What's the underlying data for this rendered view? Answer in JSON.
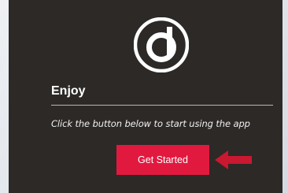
{
  "onboarding": {
    "title": "Enjoy",
    "description": "Click the button below to start using the app",
    "button_label": "Get Started"
  },
  "icons": {
    "logo": "circle-d-logo",
    "pointer": "arrow-left-icon"
  },
  "colors": {
    "panel_bg": "#2d2927",
    "accent": "#e2193f",
    "arrow": "#c9182f"
  }
}
